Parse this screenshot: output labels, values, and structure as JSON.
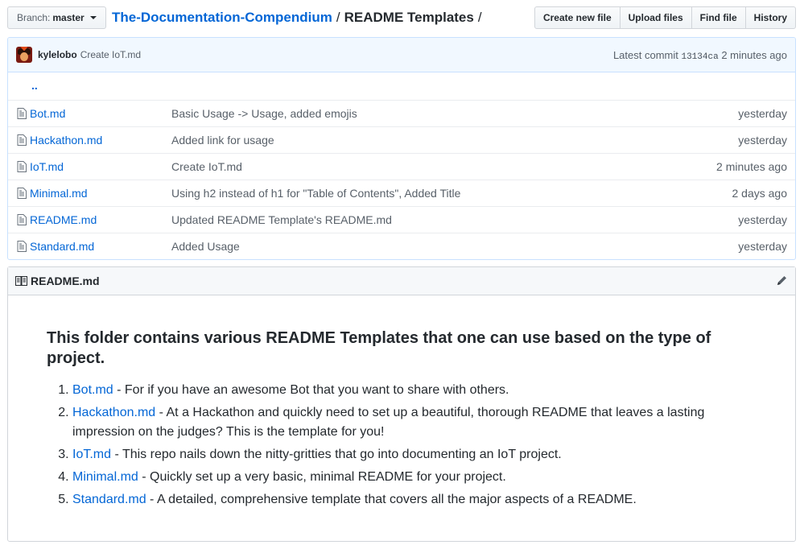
{
  "branch": {
    "prefix": "Branch:",
    "name": "master"
  },
  "breadcrumb": {
    "repo": "The-Documentation-Compendium",
    "sep1": "/",
    "dir": "README Templates",
    "sep2": "/"
  },
  "actions": {
    "create": "Create new file",
    "upload": "Upload files",
    "find": "Find file",
    "history": "History"
  },
  "commit": {
    "author": "kylelobo",
    "message": "Create IoT.md",
    "latest_label": "Latest commit",
    "sha": "13134ca",
    "age": "2 minutes ago"
  },
  "parent_link": "..",
  "files": [
    {
      "name": "Bot.md",
      "message": "Basic Usage -> Usage, added emojis",
      "age": "yesterday"
    },
    {
      "name": "Hackathon.md",
      "message": "Added link for usage",
      "age": "yesterday"
    },
    {
      "name": "IoT.md",
      "message": "Create IoT.md",
      "age": "2 minutes ago"
    },
    {
      "name": "Minimal.md",
      "message": "Using h2 instead of h1 for \"Table of Contents\", Added Title",
      "age": "2 days ago"
    },
    {
      "name": "README.md",
      "message": "Updated README Template's README.md",
      "age": "yesterday"
    },
    {
      "name": "Standard.md",
      "message": "Added Usage",
      "age": "yesterday"
    }
  ],
  "readme": {
    "title": "README.md",
    "heading": "This folder contains various README Templates that one can use based on the type of project.",
    "items": [
      {
        "link": "Bot.md",
        "text": " - For if you have an awesome Bot that you want to share with others."
      },
      {
        "link": "Hackathon.md",
        "text": " - At a Hackathon and quickly need to set up a beautiful, thorough README that leaves a lasting impression on the judges? This is the template for you!"
      },
      {
        "link": "IoT.md",
        "text": " - This repo nails down the nitty-gritties that go into documenting an IoT project."
      },
      {
        "link": "Minimal.md",
        "text": " - Quickly set up a very basic, minimal README for your project."
      },
      {
        "link": "Standard.md",
        "text": " - A detailed, comprehensive template that covers all the major aspects of a README."
      }
    ]
  },
  "colors": {
    "link": "#0366d6",
    "text": "#24292e",
    "muted": "#586069",
    "commit_bg": "#f1f8ff",
    "border": "#d1d5da"
  },
  "icons": {
    "file": "file-icon",
    "book": "book-icon",
    "pencil": "pencil-icon",
    "caret": "caret-down-icon"
  }
}
